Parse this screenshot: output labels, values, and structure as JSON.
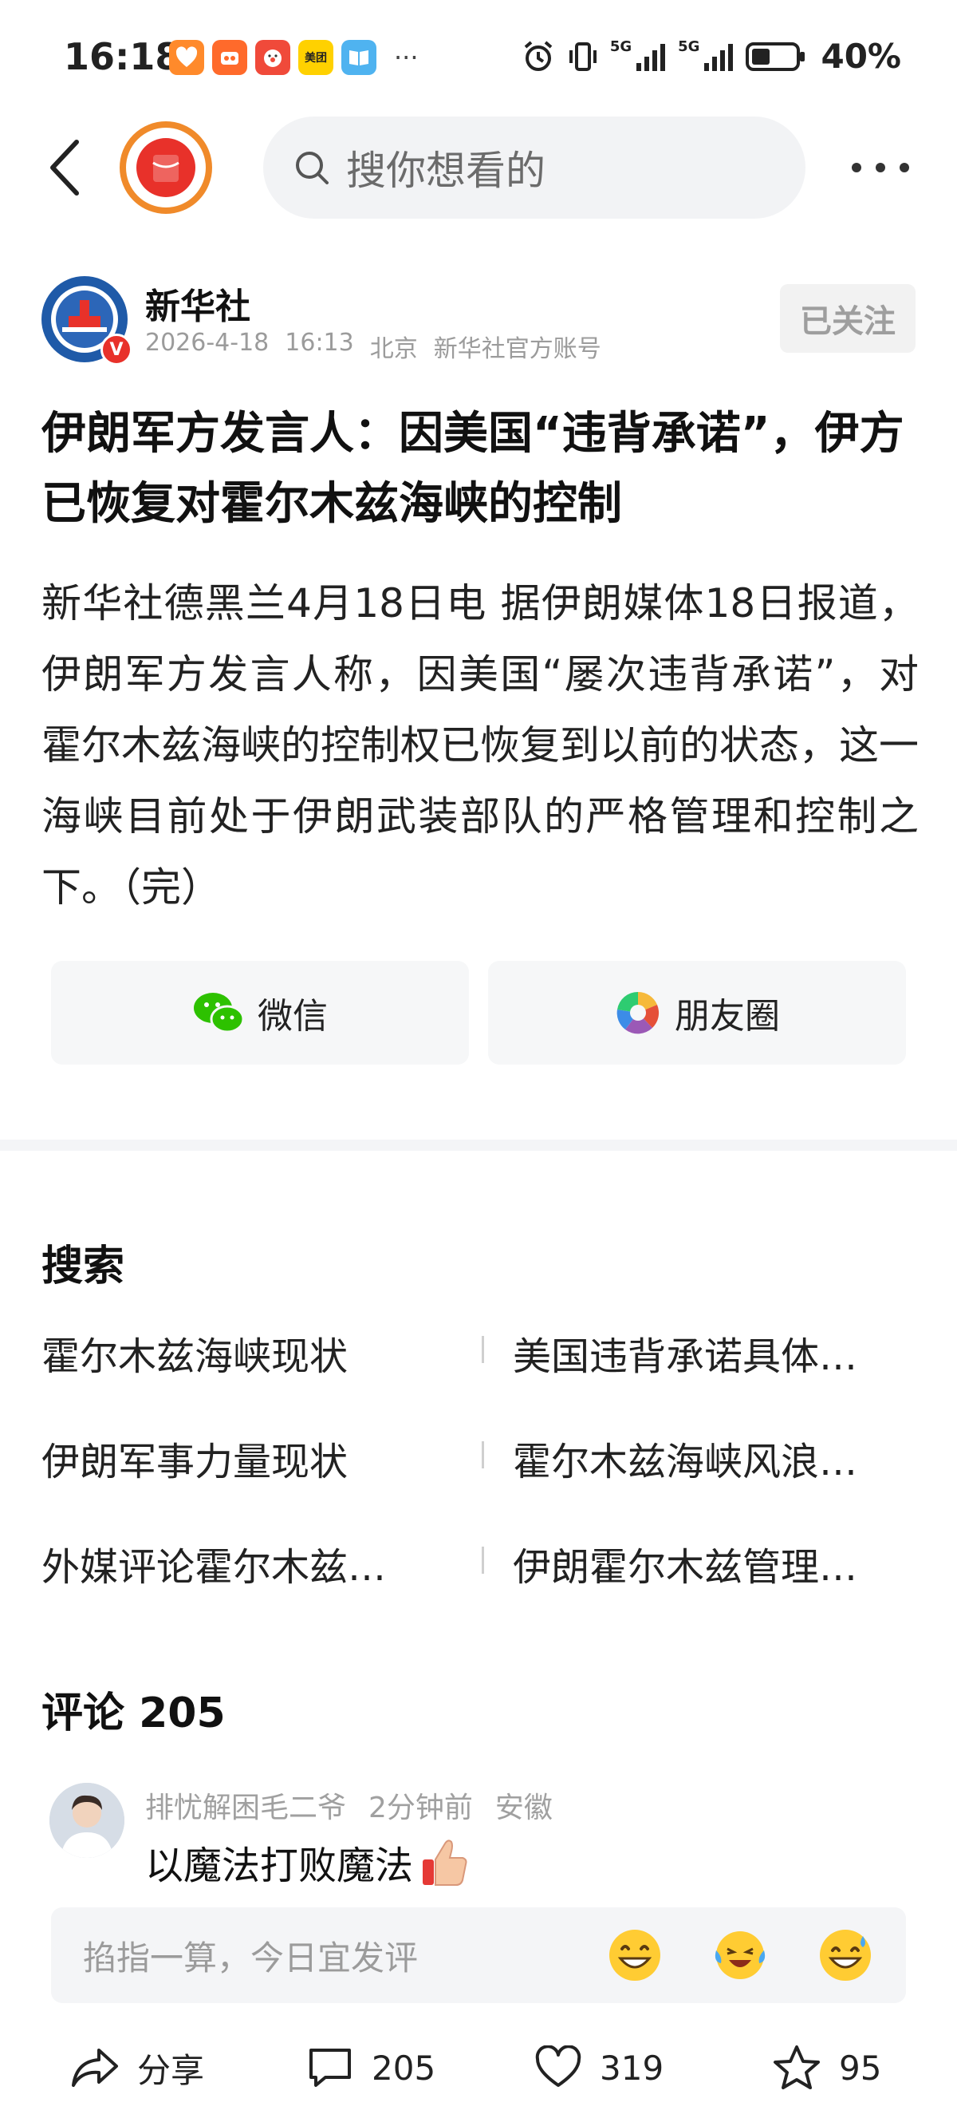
{
  "status_bar": {
    "time": "16:18",
    "apps": [
      {
        "name": "heart-app",
        "label": "",
        "color": "#ff8a2b"
      },
      {
        "name": "app-2",
        "label": "",
        "color": "#ff6a2b"
      },
      {
        "name": "app-3",
        "label": "",
        "color": "#f04a3a"
      },
      {
        "name": "meituan",
        "label": "美团",
        "color": "#ffd100"
      },
      {
        "name": "book-app",
        "label": "",
        "color": "#4fb3f0"
      }
    ],
    "more": "···",
    "network_1": "5G",
    "network_2": "5G",
    "battery": "40%"
  },
  "header": {
    "search_placeholder": "搜你想看的"
  },
  "author": {
    "name": "新华社",
    "date": "2026-4-18",
    "time": "16:13",
    "location": "北京",
    "account_type": "新华社官方账号",
    "follow_label": "已关注",
    "verified_badge": "V"
  },
  "article": {
    "title": "伊朗军方发言人：因美国“违背承诺”，伊方已恢复对霍尔木兹海峡的控制",
    "body": "新华社德黑兰4月18日电 据伊朗媒体18日报道，伊朗军方发言人称，因美国“屡次违背承诺”，对霍尔木兹海峡的控制权已恢复到以前的状态，这一海峡目前处于伊朗武装部队的严格管理和控制之下。（完）"
  },
  "share": {
    "wechat_label": "微信",
    "moments_label": "朋友圈"
  },
  "search_section": {
    "title": "搜索",
    "suggestions": [
      [
        "霍尔木兹海峡现状",
        "美国违背承诺具体…"
      ],
      [
        "伊朗军事力量现状",
        "霍尔木兹海峡风浪…"
      ],
      [
        "外媒评论霍尔木兹…",
        "伊朗霍尔木兹管理…"
      ]
    ]
  },
  "comments": {
    "title": "评论 205",
    "items": [
      {
        "user": "排忧解困毛二爷",
        "time": "2分钟前",
        "location": "安徽",
        "text": "以魔法打败魔法"
      }
    ],
    "input_placeholder": "掐指一算，今日宜发评"
  },
  "bottom_bar": {
    "share_label": "分享",
    "comment_count": "205",
    "like_count": "319",
    "favorite_count": "95"
  },
  "colors": {
    "accent_orange": "#f08a2a",
    "accent_red": "#e8312a",
    "text_muted": "#9b9b9b"
  }
}
